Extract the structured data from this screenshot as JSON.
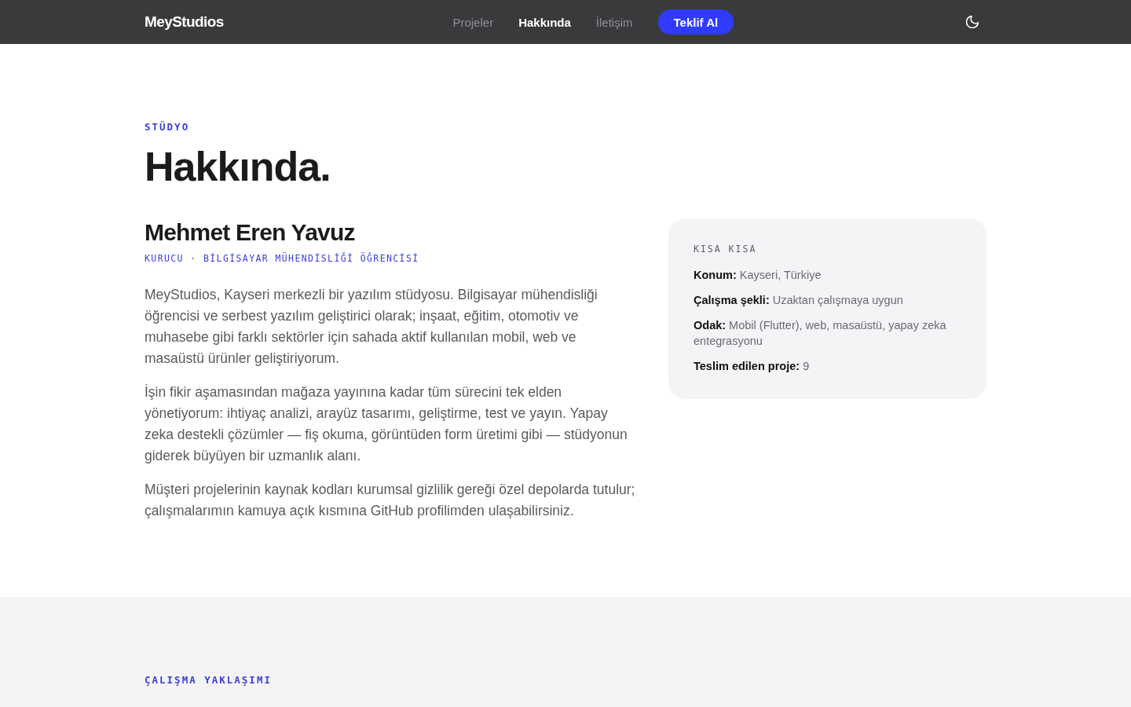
{
  "nav": {
    "logo": "MeyStudios",
    "links": [
      {
        "label": "Projeler",
        "selected": false
      },
      {
        "label": "Hakkında",
        "selected": true
      },
      {
        "label": "İletişim",
        "selected": false
      }
    ],
    "cta": "Teklif Al"
  },
  "about": {
    "eyebrow": "STÜDYO",
    "title": "Hakkında.",
    "name": "Mehmet Eren Yavuz",
    "role": "KURUCU · BİLGİSAYAR MÜHENDİSLİĞİ ÖĞRENCİSİ",
    "paragraphs": [
      "MeyStudios, Kayseri merkezli bir yazılım stüdyosu. Bilgisayar mühendisliği öğrencisi ve serbest yazılım geliştirici olarak; inşaat, eğitim, otomotiv ve muhasebe gibi farklı sektörler için sahada aktif kullanılan mobil, web ve masaüstü ürünler geliştiriyorum.",
      "İşin fikir aşamasından mağaza yayınına kadar tüm sürecini tek elden yönetiyorum: ihtiyaç analizi, arayüz tasarımı, geliştirme, test ve yayın. Yapay zeka destekli çözümler — fiş okuma, görüntüden form üretimi gibi — stüdyonun giderek büyüyen bir uzmanlık alanı.",
      "Müşteri projelerinin kaynak kodları kurumsal gizlilik gereği özel depolarda tutulur; çalışmalarımın kamuya açık kısmına GitHub profilimden ulaşabilirsiniz."
    ],
    "facts_card": {
      "title": "KISA KISA",
      "facts": [
        {
          "label": "Konum:",
          "value": "Kayseri, Türkiye"
        },
        {
          "label": "Çalışma şekli:",
          "value": "Uzaktan çalışmaya uygun"
        },
        {
          "label": "Odak:",
          "value": "Mobil (Flutter), web, masaüstü, yapay zeka entegrasyonu"
        },
        {
          "label": "Teslim edilen proje:",
          "value": "9"
        }
      ]
    }
  },
  "approach": {
    "eyebrow": "ÇALIŞMA YAKLAŞIMI"
  }
}
